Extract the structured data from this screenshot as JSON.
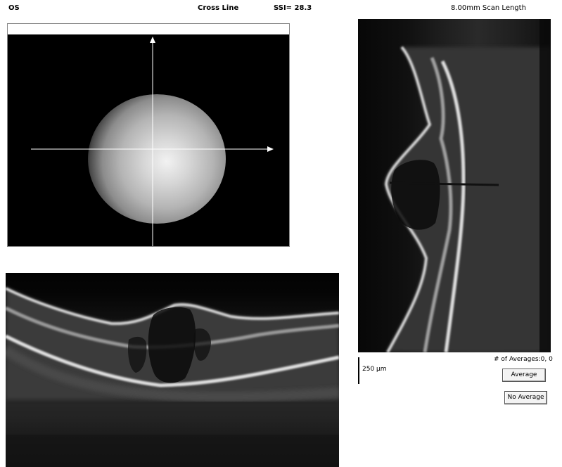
{
  "header": {
    "eye": "OS",
    "mode": "Cross Line",
    "ssi": "SSI= 28.3",
    "scan_length": "8.00mm Scan Length"
  },
  "panels": {
    "fundus": {
      "icon": "crosshair-icon"
    },
    "scale_label": "250 µm",
    "averages_label": "# of Averages:0, 0"
  },
  "buttons": {
    "average": "Average",
    "no_average": "No Average"
  }
}
